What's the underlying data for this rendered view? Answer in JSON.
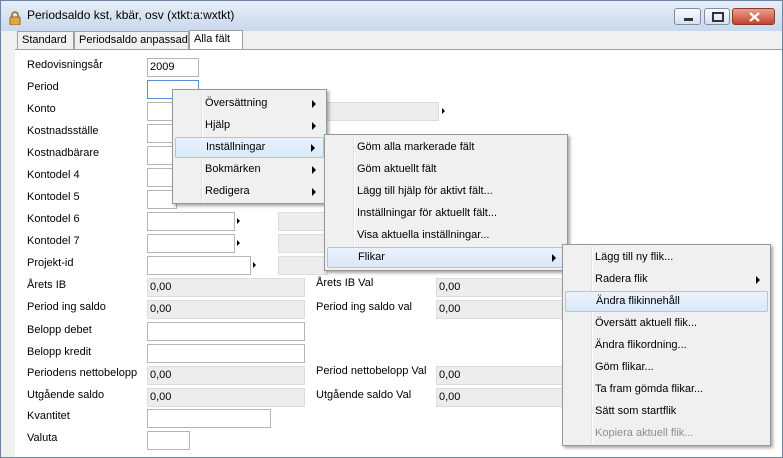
{
  "window": {
    "title": "Periodsaldo kst, kbär, osv (xtkt:a:wxtkt)"
  },
  "tabs": [
    {
      "label": "Standard"
    },
    {
      "label": "Periodsaldo anpassad"
    },
    {
      "label": "Alla fält"
    }
  ],
  "form": {
    "redovisningsar": {
      "label": "Redovisningsår",
      "value": "2009"
    },
    "period": {
      "label": "Period",
      "value": ""
    },
    "konto": {
      "label": "Konto"
    },
    "kostnadsstalle": {
      "label": "Kostnadsställe"
    },
    "kostnadbarare": {
      "label": "Kostnadbärare"
    },
    "kontodel4": {
      "label": "Kontodel 4"
    },
    "kontodel5": {
      "label": "Kontodel 5"
    },
    "kontodel6": {
      "label": "Kontodel 6"
    },
    "kontodel7": {
      "label": "Kontodel 7"
    },
    "projektid": {
      "label": "Projekt-id"
    },
    "arets_ib": {
      "label": "Årets IB",
      "value": "0,00"
    },
    "arets_ib_val": {
      "label": "Årets IB Val",
      "value": "0,00"
    },
    "period_ing_saldo": {
      "label": "Period ing saldo",
      "value": "0,00"
    },
    "period_ing_saldo_val": {
      "label": "Period ing saldo val",
      "value": "0,00"
    },
    "belopp_debet": {
      "label": "Belopp debet"
    },
    "belopp_kredit": {
      "label": "Belopp kredit"
    },
    "periodens_nettobelopp": {
      "label": "Periodens nettobelopp",
      "value": "0,00"
    },
    "period_nettobelopp_val": {
      "label": "Period nettobelopp Val",
      "value": "0,00"
    },
    "utgaende_saldo": {
      "label": "Utgående saldo",
      "value": "0,00"
    },
    "utgaende_saldo_val": {
      "label": "Utgående saldo Val",
      "value": "0,00"
    },
    "kvantitet": {
      "label": "Kvantitet"
    },
    "valuta": {
      "label": "Valuta"
    }
  },
  "context_menu": [
    {
      "label": "Översättning"
    },
    {
      "label": "Hjälp"
    },
    {
      "label": "Inställningar"
    },
    {
      "label": "Bokmärken"
    },
    {
      "label": "Redigera"
    }
  ],
  "installningar_menu": [
    {
      "label": "Göm alla markerade fält"
    },
    {
      "label": "Göm aktuellt fält"
    },
    {
      "label": "Lägg till hjälp för aktivt fält..."
    },
    {
      "label": "Inställningar för aktuellt fält..."
    },
    {
      "label": "Visa aktuella inställningar..."
    },
    {
      "label": "Flikar"
    }
  ],
  "flikar_menu": [
    {
      "label": "Lägg till ny flik..."
    },
    {
      "label": "Radera flik"
    },
    {
      "label": "Ändra flikinnehåll"
    },
    {
      "label": "Översätt aktuell flik..."
    },
    {
      "label": "Ändra flikordning..."
    },
    {
      "label": "Göm flikar..."
    },
    {
      "label": "Ta fram gömda flikar..."
    },
    {
      "label": "Sätt som startflik"
    },
    {
      "label": "Kopiera aktuell flik..."
    }
  ]
}
